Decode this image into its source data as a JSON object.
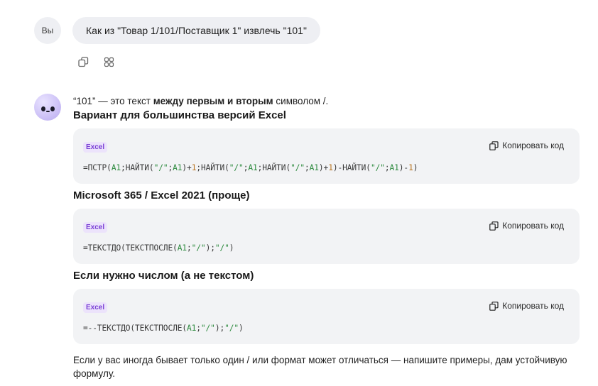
{
  "user": {
    "avatar_label": "Вы",
    "message": "Как из \"Товар 1/101/Поставщик 1\" извлечь \"101\""
  },
  "message_actions": {
    "copy_icon": "copy-icon",
    "variants_icon": "grid-icon"
  },
  "assistant": {
    "avatar_icon": "bot-face-icon",
    "intro": {
      "part1": "“101” — это текст ",
      "bold": "между первым и вторым",
      "part2": " символом /."
    },
    "sections": [
      {
        "heading": "Вариант для большинства версий Excel",
        "lang": "Excel",
        "copy_label": "Копировать код",
        "code": "=ПСТР(A1;НАЙТИ(\"/\";A1)+1;НАЙТИ(\"/\";A1;НАЙТИ(\"/\";A1)+1)-НАЙТИ(\"/\";A1)-1)"
      },
      {
        "heading": "Microsoft 365 / Excel 2021 (проще)",
        "lang": "Excel",
        "copy_label": "Копировать код",
        "code": "=ТЕКСТДО(ТЕКСТПОСЛЕ(A1;\"/\");\"/\")"
      },
      {
        "heading": "Если нужно числом (а не текстом)",
        "lang": "Excel",
        "copy_label": "Копировать код",
        "code": "=--ТЕКСТДО(ТЕКСТПОСЛЕ(A1;\"/\");\"/\")"
      }
    ],
    "footer": "Если у вас иногда бывает только один / или формат может отличаться — напишите примеры, дам устойчивую формулу."
  },
  "colors": {
    "code_string": "#2c8a3d",
    "code_number": "#b8731f",
    "badge_text": "#7a3fd6",
    "card_bg": "#f2f3f5"
  }
}
